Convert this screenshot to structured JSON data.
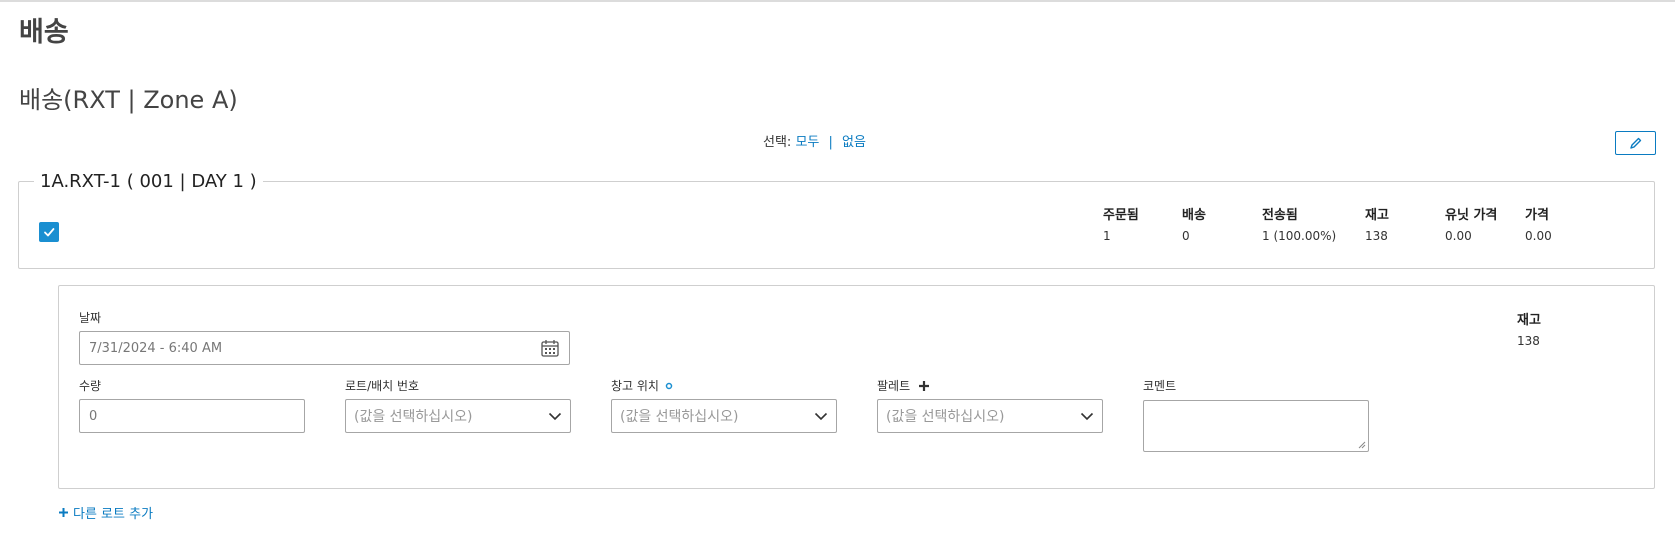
{
  "page": {
    "title": "배송"
  },
  "section": {
    "title": "배송(RXT | Zone A)"
  },
  "selection": {
    "label": "선택:",
    "all": "모두",
    "separator": "|",
    "none": "없음"
  },
  "toolbar": {
    "edit_icon": "pencil-icon"
  },
  "item": {
    "legend": "1A.RXT-1 ( 001 | DAY 1 )",
    "checked": true,
    "stats": {
      "ordered_label": "주문됨",
      "ordered_value": "1",
      "shipped_label": "배송",
      "shipped_value": "0",
      "sent_label": "전송됨",
      "sent_value": "1 (100.00%)",
      "stock_label": "재고",
      "stock_value": "138",
      "unit_price_label": "유닛 가격",
      "unit_price_value": "0.00",
      "price_label": "가격",
      "price_value": "0.00"
    }
  },
  "lot": {
    "date_label": "날짜",
    "date_value": "7/31/2024 - 6:40 AM",
    "stock_label": "재고",
    "stock_value": "138",
    "quantity_label": "수량",
    "quantity_value": "0",
    "lot_label": "로트/배치 번호",
    "lot_placeholder": "(값을 선택하십시오)",
    "warehouse_label": "창고 위치",
    "warehouse_placeholder": "(값을 선택하십시오)",
    "pallet_label": "팔레트",
    "pallet_placeholder": "(값을 선택하십시오)",
    "comment_label": "코멘트",
    "comment_value": ""
  },
  "actions": {
    "add_lot": "다른 로트 추가"
  },
  "colors": {
    "accent": "#0a7bc1",
    "checkbox": "#1a8fd1",
    "border": "#cfcfcf"
  }
}
